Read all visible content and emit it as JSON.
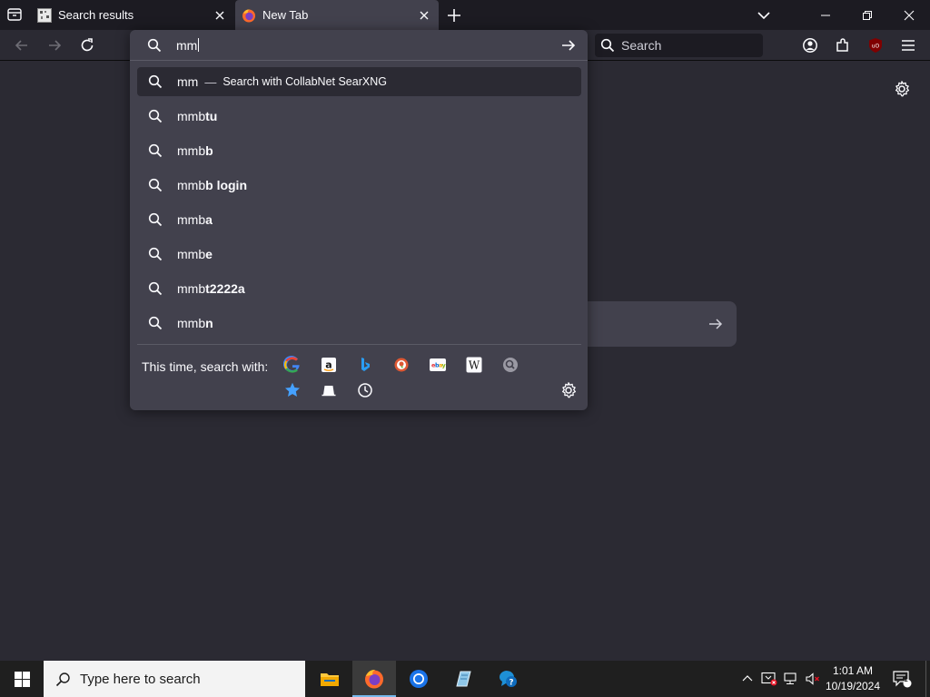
{
  "tabs": [
    {
      "title": "Search results",
      "favicon": "searxng-favicon"
    },
    {
      "title": "New Tab",
      "favicon": "firefox-icon"
    }
  ],
  "navbar": {
    "search_placeholder": "Search"
  },
  "urlbar": {
    "typed": "mm",
    "heuristic": {
      "text": "mm",
      "dash": "—",
      "action": "Search with CollabNet SearXNG"
    },
    "suggestions": [
      {
        "prefix": "mmb",
        "bold": "tu"
      },
      {
        "prefix": "mmb",
        "bold": "b"
      },
      {
        "prefix": "mmb",
        "bold": "b login"
      },
      {
        "prefix": "mmb",
        "bold": "a"
      },
      {
        "prefix": "mmb",
        "bold": "e"
      },
      {
        "prefix": "mmb",
        "bold": "t2222a"
      },
      {
        "prefix": "mmb",
        "bold": "n"
      }
    ],
    "one_off_label": "This time, search with:",
    "engines": [
      "google-icon",
      "amazon-icon",
      "bing-icon",
      "duckduckgo-icon",
      "ebay-icon",
      "wikipedia-icon",
      "searxng-icon",
      "bookmarks-star-icon",
      "tabs-icon",
      "history-clock-icon"
    ]
  },
  "taskbar": {
    "search_placeholder": "Type here to search",
    "time": "1:01 AM",
    "date": "10/19/2024",
    "notification_count": "1"
  },
  "colors": {
    "page_bg": "#2b2a33",
    "chrome_bg": "#1c1b22",
    "popup_bg": "#42414d",
    "accent": "#76b9ed"
  }
}
